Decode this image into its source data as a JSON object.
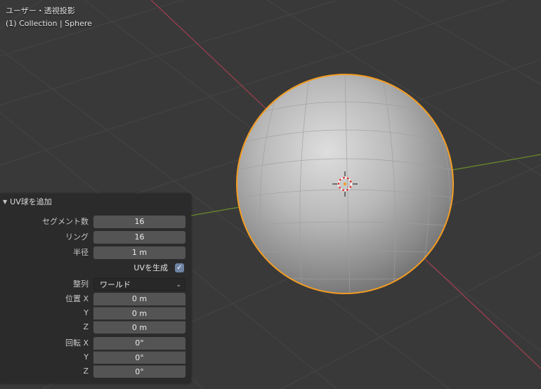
{
  "viewport": {
    "view_name": "ユーザー・透視投影",
    "object_info": "(1) Collection | Sphere",
    "colors": {
      "background": "#393939",
      "grid": "#454545",
      "x_axis": "#9a3e4e",
      "y_axis": "#6a8a2c",
      "selection_outline": "#f39c22"
    },
    "selected_object": "Sphere"
  },
  "operator_panel": {
    "title": "UV球を追加",
    "collapse_icon": "triangle-down-icon",
    "segments": {
      "label": "セグメント数",
      "value": "16"
    },
    "rings": {
      "label": "リング",
      "value": "16"
    },
    "radius": {
      "label": "半径",
      "value": "1 m"
    },
    "generate_uvs": {
      "label": "UVを生成",
      "checked": true
    },
    "align": {
      "label": "整列",
      "value": "ワールド"
    },
    "location": {
      "label_x": "位置 X",
      "label_y": "Y",
      "label_z": "Z",
      "x": "0 m",
      "y": "0 m",
      "z": "0 m"
    },
    "rotation": {
      "label_x": "回転 X",
      "label_y": "Y",
      "label_z": "Z",
      "x": "0°",
      "y": "0°",
      "z": "0°"
    }
  }
}
